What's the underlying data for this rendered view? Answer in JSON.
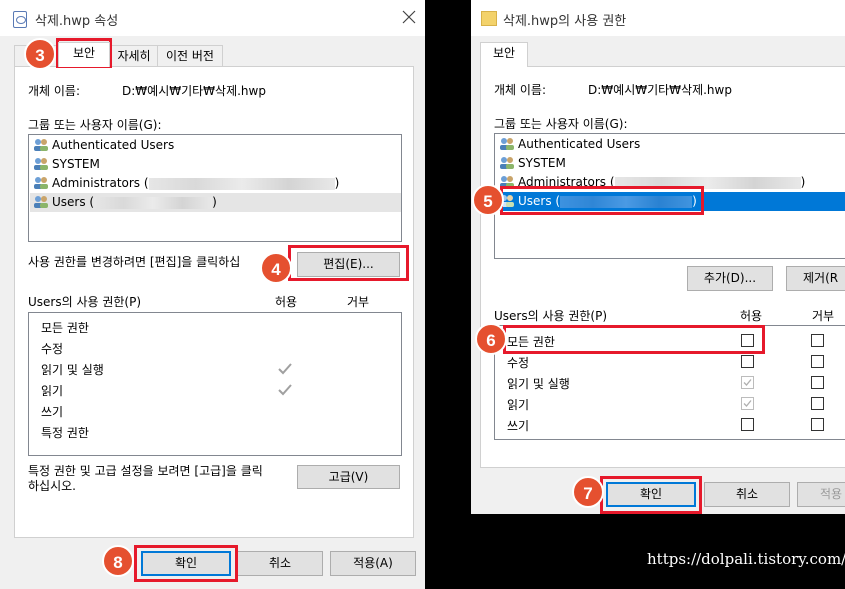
{
  "colors": {
    "badge": "#e5502f",
    "highlight": "#e6192b",
    "selection": "#0078d7"
  },
  "left_dialog": {
    "title": "삭제.hwp 속성",
    "tabs": [
      "보안",
      "자세히",
      "이전 버전"
    ],
    "object_name_label": "개체 이름:",
    "object_name_value": "D:₩예시₩기타₩삭제.hwp",
    "group_label": "그룹 또는 사용자 이름(G):",
    "users": [
      {
        "name": "Authenticated Users",
        "suffix": ""
      },
      {
        "name": "SYSTEM",
        "suffix": ""
      },
      {
        "name": "Administrators (",
        "suffix": ")"
      },
      {
        "name": "Users (",
        "suffix": ")"
      }
    ],
    "edit_prompt": "사용 권한를 변경하려면 [편집]을 클릭하십",
    "edit_button": "편집(E)...",
    "perm_title": "Users의 사용 권한(P)",
    "allow_header": "허용",
    "deny_header": "거부",
    "permissions": [
      "모든 권한",
      "수정",
      "읽기 및 실행",
      "읽기",
      "쓰기",
      "특정 권한"
    ],
    "advanced_text": "특정 권한 및 고급 설정을 보려면 [고급]을 클릭\n하십시오.",
    "advanced_button": "고급(V)",
    "ok_button": "확인",
    "cancel_button": "취소",
    "apply_button": "적용(A)"
  },
  "right_dialog": {
    "title": "삭제.hwp의 사용 권한",
    "tab": "보안",
    "object_name_label": "개체 이름:",
    "object_name_value": "D:₩예시₩기타₩삭제.hwp",
    "group_label": "그룹 또는 사용자 이름(G):",
    "users": [
      {
        "name": "Authenticated Users",
        "suffix": ""
      },
      {
        "name": "SYSTEM",
        "suffix": ""
      },
      {
        "name": "Administrators (",
        "suffix": ")"
      },
      {
        "name": "Users (",
        "suffix": ")"
      }
    ],
    "add_button": "추가(D)...",
    "remove_button": "제거(R",
    "perm_title": "Users의 사용 권한(P)",
    "allow_header": "허용",
    "deny_header": "거부",
    "permissions": [
      "모든 권한",
      "수정",
      "읽기 및 실행",
      "읽기",
      "쓰기"
    ],
    "ok_button": "확인",
    "cancel_button": "취소",
    "apply_button": "적용"
  },
  "badges": [
    "3",
    "4",
    "5",
    "6",
    "7",
    "8"
  ],
  "watermark": "https://dolpali.tistory.com/"
}
